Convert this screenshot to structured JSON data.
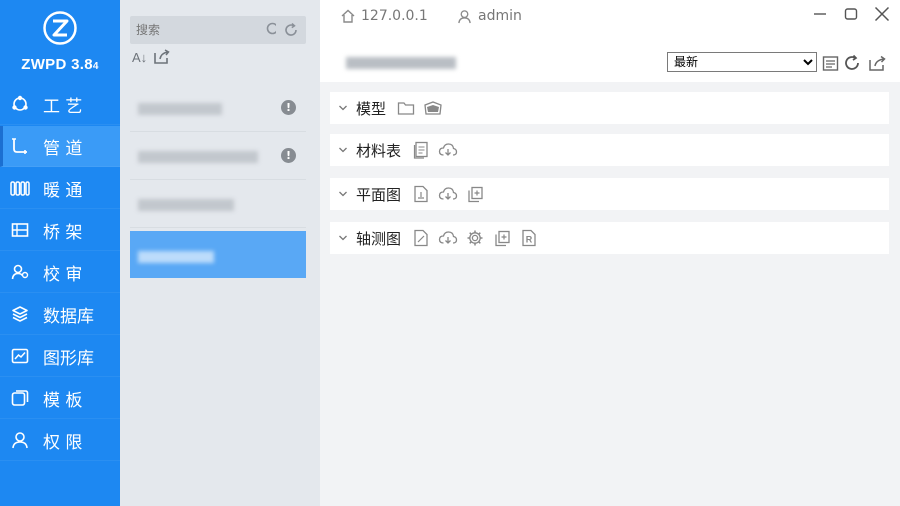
{
  "brand": {
    "name": "ZWPD 3.8",
    "version_suffix": "4"
  },
  "nav": [
    {
      "id": "craft",
      "label": "工 艺",
      "icon": "workflow-icon",
      "active": false
    },
    {
      "id": "pipe",
      "label": "管 道",
      "icon": "pipe-icon",
      "active": true
    },
    {
      "id": "hvac",
      "label": "暖 通",
      "icon": "radiator-icon",
      "active": false
    },
    {
      "id": "bridge",
      "label": "桥 架",
      "icon": "tray-icon",
      "active": false
    },
    {
      "id": "review",
      "label": "校 审",
      "icon": "reviewer-icon",
      "active": false
    },
    {
      "id": "database",
      "label": "数据库",
      "icon": "layers-icon",
      "active": false
    },
    {
      "id": "graphics",
      "label": "图形库",
      "icon": "chart-icon",
      "active": false
    },
    {
      "id": "template",
      "label": "模 板",
      "icon": "template-icon",
      "active": false
    },
    {
      "id": "permission",
      "label": "权 限",
      "icon": "user-icon",
      "active": false
    }
  ],
  "search": {
    "placeholder": "搜索",
    "value": ""
  },
  "sort_label": "A↓",
  "topbar": {
    "host": "127.0.0.1",
    "user": "admin"
  },
  "version_select": {
    "selected": "最新",
    "options": [
      "最新"
    ]
  },
  "sections": [
    {
      "title": "模型",
      "icons": [
        "folder-icon",
        "open-box-icon"
      ]
    },
    {
      "title": "材料表",
      "icons": [
        "document-icon",
        "cloud-download-icon"
      ]
    },
    {
      "title": "平面图",
      "icons": [
        "drawing-icon",
        "cloud-download-icon",
        "copy-icon"
      ]
    },
    {
      "title": "轴测图",
      "icons": [
        "drawing-icon",
        "cloud-download-icon",
        "gear-icon",
        "copy-icon",
        "r-file-icon"
      ]
    }
  ],
  "colors": {
    "nav_bg": "#1d88f2",
    "nav_active": "#3a9bf7",
    "list_bg": "#e4e8ed",
    "selected_item": "#59a8f5",
    "content_bg": "#f2f3f5"
  }
}
